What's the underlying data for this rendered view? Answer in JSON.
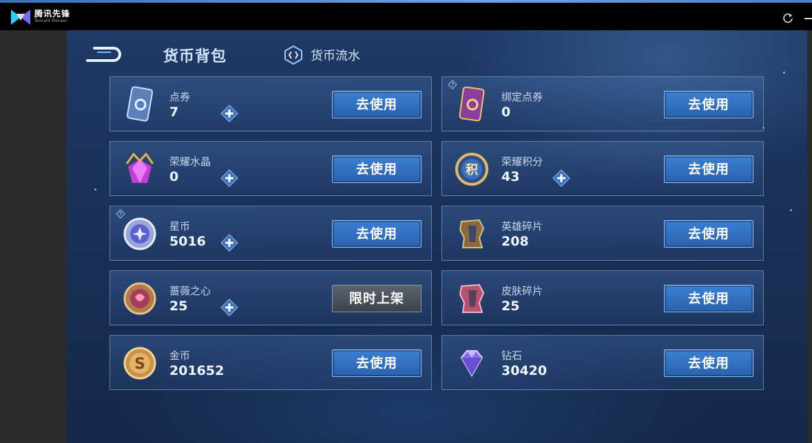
{
  "window": {
    "brand_name": "腾讯先锋",
    "brand_subtitle": "Tencent Pioneer",
    "refresh_icon": "refresh-icon",
    "minimize_icon": "minimize-icon"
  },
  "header": {
    "title": "货币背包",
    "flow_tab_label": "货币流水"
  },
  "currencies": [
    {
      "name": "点券",
      "value": "7",
      "action": "去使用",
      "icon": "voucher-card-icon",
      "has_plus": true,
      "has_info": false
    },
    {
      "name": "绑定点券",
      "value": "0",
      "action": "去使用",
      "icon": "bound-voucher-card-icon",
      "has_plus": false,
      "has_info": true
    },
    {
      "name": "荣耀水晶",
      "value": "0",
      "action": "去使用",
      "icon": "glory-crystal-icon",
      "has_plus": true,
      "has_info": false
    },
    {
      "name": "荣耀积分",
      "value": "43",
      "action": "去使用",
      "icon": "glory-points-icon",
      "has_plus": true,
      "has_info": false
    },
    {
      "name": "星币",
      "value": "5016",
      "action": "去使用",
      "icon": "star-coin-icon",
      "has_plus": true,
      "has_info": true
    },
    {
      "name": "英雄碎片",
      "value": "208",
      "action": "去使用",
      "icon": "hero-fragment-icon",
      "has_plus": false,
      "has_info": false
    },
    {
      "name": "蔷薇之心",
      "value": "25",
      "action": "限时上架",
      "icon": "rose-heart-icon",
      "has_plus": true,
      "has_info": false
    },
    {
      "name": "皮肤碎片",
      "value": "25",
      "action": "去使用",
      "icon": "skin-fragment-icon",
      "has_plus": false,
      "has_info": false
    },
    {
      "name": "金币",
      "value": "201652",
      "action": "去使用",
      "icon": "gold-coin-icon",
      "has_plus": false,
      "has_info": false
    },
    {
      "name": "钻石",
      "value": "30420",
      "action": "去使用",
      "icon": "diamond-icon",
      "has_plus": false,
      "has_info": false
    }
  ],
  "colors": {
    "accent_button": "#2f6dbf",
    "disabled_button": "#4a5059",
    "panel_bg": "#1a3159"
  }
}
